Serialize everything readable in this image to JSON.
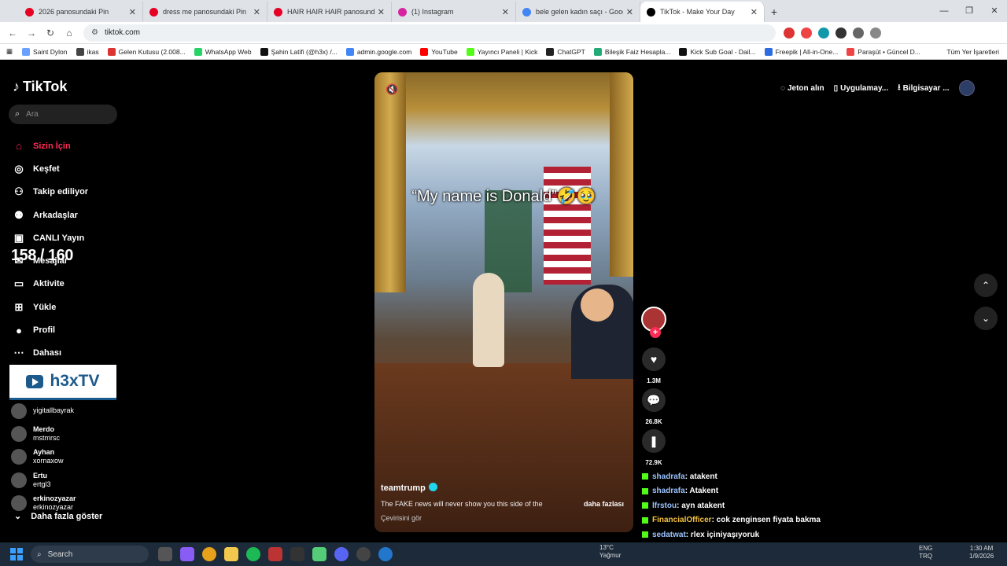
{
  "browser": {
    "tabs": [
      {
        "title": "2026 panosundaki Pin",
        "color": "#e60023",
        "active": false
      },
      {
        "title": "dress me panosundaki Pin",
        "color": "#e60023",
        "active": false
      },
      {
        "title": "HAIR HAIR HAIR panosundaki Pin",
        "color": "#e60023",
        "active": false
      },
      {
        "title": "(1) Instagram",
        "color": "#d6249f",
        "active": false
      },
      {
        "title": "bele gelen kadın saçı - Google",
        "color": "#4285f4",
        "active": false
      },
      {
        "title": "TikTok - Make Your Day",
        "color": "#000000",
        "active": true
      }
    ],
    "url": "tiktok.com",
    "bookmarks": [
      "Saint Dylon",
      "ikas",
      "Gelen Kutusu (2.008...",
      "WhatsApp Web",
      "Şahin Latifi (@h3x) /...",
      "admin.google.com",
      "YouTube",
      "Yayıncı Paneli | Kick",
      "ChatGPT",
      "Bileşik Faiz Hesapla...",
      "Kick Sub Goal - Dail...",
      "Freepik | All-in-One...",
      "Paraşüt • Güncel D..."
    ],
    "bookmarks_all": "Tüm Yer İşaretleri"
  },
  "tiktok": {
    "logo": "TikTok",
    "search_placeholder": "Ara",
    "nav": [
      {
        "label": "Sizin İçin",
        "icon": "home-icon",
        "active": true
      },
      {
        "label": "Keşfet",
        "icon": "compass-icon",
        "active": false
      },
      {
        "label": "Takip ediliyor",
        "icon": "following-icon",
        "active": false
      },
      {
        "label": "Arkadaşlar",
        "icon": "friends-icon",
        "active": false
      },
      {
        "label": "CANLI Yayın",
        "icon": "live-icon",
        "active": false
      },
      {
        "label": "Mesajlar",
        "icon": "messages-icon",
        "active": false
      },
      {
        "label": "Aktivite",
        "icon": "activity-icon",
        "active": false
      },
      {
        "label": "Yükle",
        "icon": "upload-icon",
        "active": false
      },
      {
        "label": "Profil",
        "icon": "profile-icon",
        "active": false
      },
      {
        "label": "Dahası",
        "icon": "more-icon",
        "active": false
      }
    ],
    "overlay_counter": "158 / 160",
    "h3x_badge": "h3xTV",
    "following": [
      {
        "name": "",
        "handle": "yigitallbayrak"
      },
      {
        "name": "Merdo",
        "handle": "mstmrsc"
      },
      {
        "name": "Ayhan",
        "handle": "xornaxow"
      },
      {
        "name": "Ertu",
        "handle": "ertgl3"
      },
      {
        "name": "erkinozyazar",
        "handle": "erkinozyazar"
      }
    ],
    "show_more": "Daha fazla göster",
    "top_actions": [
      "Jeton alın",
      "Uygulamay...",
      "Bilgisayar ..."
    ],
    "video": {
      "caption": "“My name is Donald”🤣🥹",
      "author": "teamtrump",
      "description": "The FAKE news will never show you this side of the",
      "more": "daha fazlası",
      "translate": "Çevirisini gör"
    },
    "stats": {
      "likes": "1.3M",
      "comments": "26.8K",
      "saves": "72.9K"
    }
  },
  "chat": [
    {
      "user": "shadrafa",
      "text": ": atakent",
      "gold": false
    },
    {
      "user": "shadrafa",
      "text": ": Atakent",
      "gold": false
    },
    {
      "user": "lfrstou",
      "text": ": ayn atakent",
      "gold": false
    },
    {
      "user": "FinancialOfficer",
      "text": ": cok zenginsen fiyata bakma",
      "gold": true
    },
    {
      "user": "sedatwat",
      "text": ": rlex içiniyaşıyoruk",
      "gold": false
    }
  ],
  "taskbar": {
    "search": "Search",
    "weather_temp": "13°C",
    "weather_desc": "Yağmur",
    "lang": "ENG",
    "lang2": "TRQ",
    "time": "1:30 AM",
    "date": "1/9/2026"
  }
}
